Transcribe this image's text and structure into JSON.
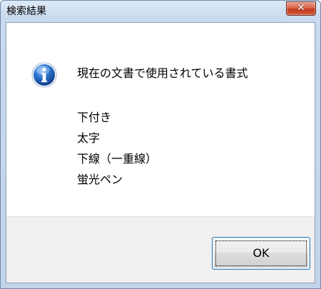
{
  "window": {
    "title": "検索結果",
    "close_icon": "close-icon"
  },
  "message": {
    "icon": "info-icon",
    "heading": "現在の文書で使用されている書式",
    "items": [
      "下付き",
      "太字",
      "下線（一重線）",
      "蛍光ペン"
    ]
  },
  "buttons": {
    "ok_label": "OK"
  },
  "colors": {
    "icon_blue": "#1f5fbf",
    "close_red": "#c9452a",
    "button_border": "#3c7fb1"
  }
}
